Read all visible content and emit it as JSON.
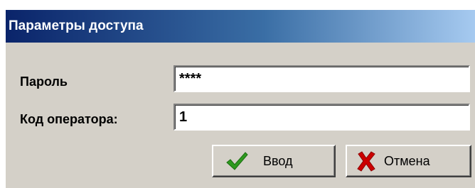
{
  "dialog": {
    "title": "Параметры доступа"
  },
  "form": {
    "password_label": "Пароль",
    "password_value": "****",
    "operator_label": "Код оператора:",
    "operator_value": "1"
  },
  "buttons": {
    "ok_label": "Ввод",
    "ok_icon": "checkmark-icon",
    "cancel_label": "Отмена",
    "cancel_icon": "cross-icon"
  },
  "colors": {
    "title_start": "#0a246a",
    "title_end": "#a6caf0",
    "dialog_bg": "#d4d0c8",
    "check_green": "#2e9a1f",
    "cross_red": "#cc0000"
  }
}
